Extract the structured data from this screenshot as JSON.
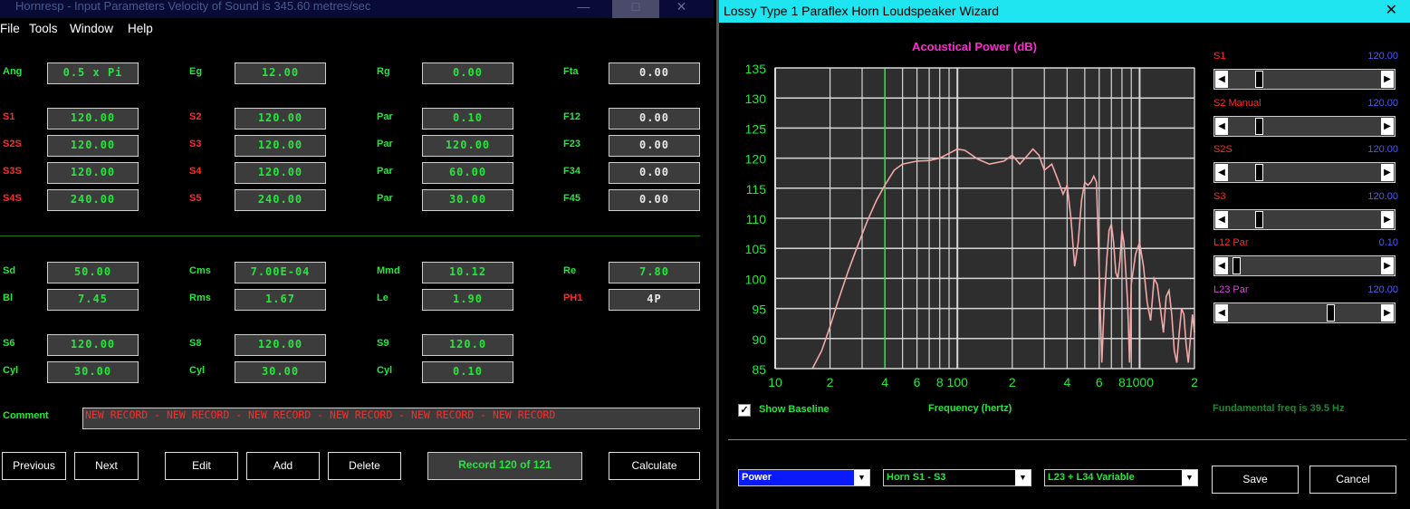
{
  "left_window": {
    "title": "Hornresp - Input Parameters   Velocity of Sound is 345.60 metres/sec",
    "controls": {
      "minimize": "—",
      "maximize": "□",
      "close": "✕"
    },
    "menu": [
      "File",
      "Tools",
      "Window",
      "Help"
    ],
    "params": [
      {
        "label": "Ang",
        "color": "green",
        "value": "0.5 x Pi"
      },
      {
        "label": "Eg",
        "color": "green",
        "value": "12.00"
      },
      {
        "label": "Rg",
        "color": "green",
        "value": "0.00"
      },
      {
        "label": "Fta",
        "color": "green",
        "value": "0.00",
        "style": "white"
      },
      {
        "label": "S1",
        "color": "red",
        "value": "120.00"
      },
      {
        "label": "S2",
        "color": "red",
        "value": "120.00"
      },
      {
        "label": "Par",
        "color": "green",
        "value": "0.10"
      },
      {
        "label": "F12",
        "color": "green",
        "value": "0.00",
        "style": "white"
      },
      {
        "label": "S2S",
        "color": "red",
        "value": "120.00"
      },
      {
        "label": "S3",
        "color": "red",
        "value": "120.00"
      },
      {
        "label": "Par",
        "color": "green",
        "value": "120.00"
      },
      {
        "label": "F23",
        "color": "green",
        "value": "0.00",
        "style": "white"
      },
      {
        "label": "S3S",
        "color": "red",
        "value": "120.00"
      },
      {
        "label": "S4",
        "color": "red",
        "value": "120.00"
      },
      {
        "label": "Par",
        "color": "green",
        "value": "60.00"
      },
      {
        "label": "F34",
        "color": "green",
        "value": "0.00",
        "style": "white"
      },
      {
        "label": "S4S",
        "color": "red",
        "value": "240.00"
      },
      {
        "label": "S5",
        "color": "red",
        "value": "240.00"
      },
      {
        "label": "Par",
        "color": "green",
        "value": "30.00"
      },
      {
        "label": "F45",
        "color": "green",
        "value": "0.00",
        "style": "white"
      },
      {
        "label": "Sd",
        "color": "green",
        "value": "50.00"
      },
      {
        "label": "Cms",
        "color": "green",
        "value": "7.00E-04"
      },
      {
        "label": "Mmd",
        "color": "green",
        "value": "10.12"
      },
      {
        "label": "Re",
        "color": "green",
        "value": "7.80"
      },
      {
        "label": "Bl",
        "color": "green",
        "value": "7.45"
      },
      {
        "label": "Rms",
        "color": "green",
        "value": "1.67"
      },
      {
        "label": "Le",
        "color": "green",
        "value": "1.90"
      },
      {
        "label": "PH1",
        "color": "red",
        "value": "4P",
        "style": "white"
      },
      {
        "label": "S6",
        "color": "green",
        "value": "120.00"
      },
      {
        "label": "S8",
        "color": "green",
        "value": "120.00"
      },
      {
        "label": "S9",
        "color": "green",
        "value": "120.0"
      },
      {
        "label": "Cyl",
        "color": "green",
        "value": "30.00"
      },
      {
        "label": "Cyl",
        "color": "green",
        "value": "30.00"
      },
      {
        "label": "Cyl",
        "color": "green",
        "value": "0.10"
      }
    ],
    "comment_label": "Comment",
    "comment_value": "NEW RECORD - NEW RECORD - NEW RECORD - NEW RECORD - NEW RECORD - NEW RECORD",
    "buttons": {
      "previous": "Previous",
      "next": "Next",
      "edit": "Edit",
      "add": "Add",
      "delete": "Delete",
      "calculate": "Calculate"
    },
    "record_status": "Record 120 of 121"
  },
  "right_window": {
    "title": "Lossy Type 1 Paraflex Horn Loudspeaker Wizard",
    "close": "✕",
    "sliders": [
      {
        "label": "S1",
        "label_color": "#ff2a2a",
        "value": "120.00",
        "position": 0.17
      },
      {
        "label": "S2  Manual",
        "label_color": "#ff2a2a",
        "value": "120.00",
        "position": 0.17
      },
      {
        "label": "S2S",
        "label_color": "#ff2a2a",
        "value": "120.00",
        "position": 0.17
      },
      {
        "label": "S3",
        "label_color": "#ff2a2a",
        "value": "120.00",
        "position": 0.17
      },
      {
        "label": "L12  Par",
        "label_color": "#ff2a2a",
        "value": "0.10",
        "position": 0.02
      },
      {
        "label": "L23  Par",
        "label_color": "#e040e0",
        "value": "120.00",
        "position": 0.65
      }
    ],
    "show_baseline_label": "Show Baseline",
    "show_baseline_checked": true,
    "fundamental": "Fundamental freq is 39.5 Hz",
    "dropdowns": {
      "view": "Power",
      "horn": "Horn S1 - S3",
      "variable": "L23 + L34 Variable"
    },
    "buttons": {
      "save": "Save",
      "cancel": "Cancel"
    }
  },
  "chart_data": {
    "type": "line",
    "title": "Acoustical Power (dB)",
    "xlabel": "Frequency (hertz)",
    "ylabel": "",
    "xscale": "log",
    "xlim": [
      10,
      2000
    ],
    "ylim": [
      85,
      135
    ],
    "yticks": [
      85,
      90,
      95,
      100,
      105,
      110,
      115,
      120,
      125,
      130,
      135
    ],
    "xtick_labels": [
      "10",
      "2",
      "4",
      "6",
      "8",
      "100",
      "2",
      "4",
      "6",
      "8",
      "1000",
      "2"
    ],
    "grid": true,
    "marker_line_x": 40,
    "line_color": "#f4a8a8",
    "series": [
      {
        "x": [
          16,
          18,
          20,
          22,
          25,
          28,
          32,
          36,
          40,
          45,
          50,
          60,
          70,
          80,
          90,
          100,
          110,
          130,
          150,
          180,
          200,
          220,
          240,
          260,
          280,
          300,
          330,
          360,
          380,
          400,
          420,
          440,
          460,
          480,
          500,
          520,
          540,
          560,
          580,
          600,
          620,
          640,
          660,
          680,
          700,
          720,
          740,
          760,
          780,
          800,
          820,
          840,
          860,
          880,
          900,
          950,
          1000,
          1050,
          1100,
          1150,
          1200,
          1250,
          1300,
          1350,
          1400,
          1450,
          1500,
          1550,
          1600,
          1650,
          1700,
          1750,
          1800,
          1850,
          1900,
          1950,
          2000
        ],
        "y": [
          85,
          88,
          92,
          96,
          101,
          105,
          109.5,
          113,
          115.5,
          118,
          119,
          119.5,
          119.6,
          120,
          120.8,
          121.5,
          121.3,
          119.8,
          119,
          119.5,
          120.5,
          119,
          120.3,
          121.5,
          120.5,
          118,
          119,
          116,
          114,
          115.5,
          110,
          102,
          106,
          113,
          116,
          115.5,
          116,
          117,
          116,
          101,
          86,
          96,
          103,
          108,
          109,
          106,
          101,
          100,
          103,
          108,
          106,
          101,
          96,
          86,
          99,
          104,
          106,
          102,
          96,
          93,
          100,
          99,
          95,
          91,
          97,
          98,
          94,
          88,
          86,
          91,
          95,
          94,
          89,
          86,
          90,
          94,
          91
        ]
      }
    ]
  }
}
